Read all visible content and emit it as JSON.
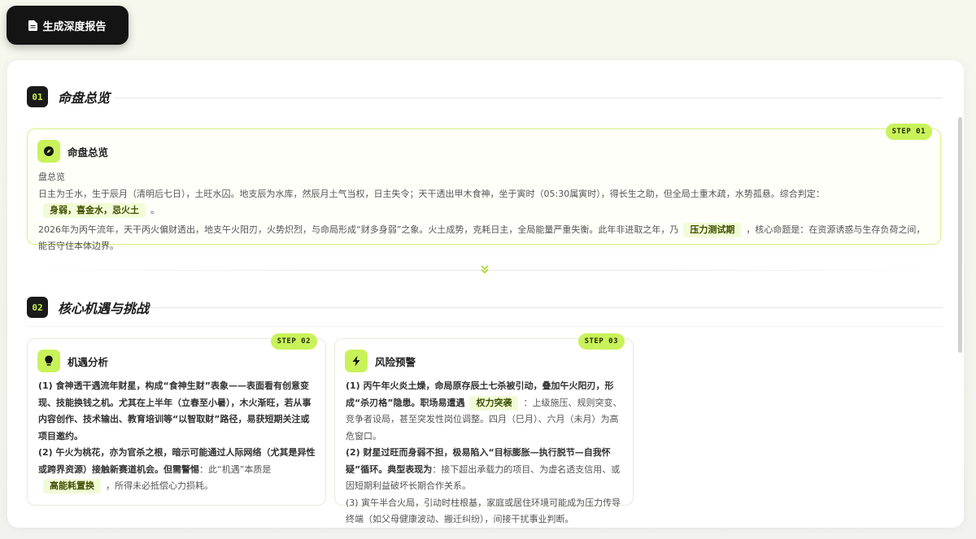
{
  "top_button": {
    "label": "生成深度报告",
    "icon": "document-icon"
  },
  "section1": {
    "number": "01",
    "title": "命盘总览"
  },
  "card1": {
    "step": "STEP 01",
    "title": "命盘总览",
    "icon": "compass-icon",
    "subtitle": "盘总览",
    "para1_text": "日主为壬水，生于辰月（清明后七日），土旺水囚。地支辰为水库，然辰月土气当权，日主失令；天干透出甲木食神，坐于寅时（05:30属寅时），得长生之助，但全局土重木疏，水势孤悬。综合判定：",
    "para1_tag": "身弱，喜金水，忌火土",
    "para1_end": "。",
    "para2_text": "2026年为丙午流年，天干丙火偏财透出，地支午火阳刃，火势炽烈，与命局形成“财多身弱”之象。火土成势，克耗日主，全局能量严重失衡。此年非进取之年，乃",
    "para2_tag": "压力测试期",
    "para2_end": "，核心命题是：在资源诱惑与生存负荷之间，能否守住本体边界。"
  },
  "section2": {
    "number": "02",
    "title": "核心机遇与挑战"
  },
  "card2": {
    "step": "STEP 02",
    "title": "机遇分析",
    "icon": "lightbulb-icon",
    "p1_strong": "(1) 食神透干遇流年财星，构成“食神生财”表象——表面看有创意变现、技能换钱之机。尤其在上半年（立春至小暑），木火渐旺，若从事内容创作、技术输出、教育培训等“以智取财”路径，易获短期关注或项目邀约。",
    "p2_strong": "(2) 午火为桃花，亦为官杀之根，暗示可能通过人际网络（尤其是异性或跨界资源）接触新赛道机会。但需警惕",
    "p2_text": "：此“机遇”本质是",
    "p2_tag": "高能耗置换",
    "p2_end": "，所得未必抵偿心力损耗。"
  },
  "card3": {
    "step": "STEP 03",
    "title": "风险预警",
    "icon": "lightning-icon",
    "p1_strong": "(1) 丙午年火炎土燥，命局原存辰土七杀被引动，叠加午火阳刃，形成“杀刃格”隐患。职场易遭遇",
    "p1_tag": "权力突袭",
    "p1_text": "：上级施压、规则突变、竞争者设局，甚至突发性岗位调整。四月（巳月）、六月（未月）为高危窗口。",
    "p2_strong": "(2) 财星过旺而身弱不担，极易陷入“目标膨胀—执行脱节—自我怀疑”循环。典型表现为",
    "p2_text": "：接下超出承载力的项目、为虚名透支信用、或因短期利益破坏长期合作关系。",
    "p3_text": "(3) 寅午半合火局，引动时柱根基，家庭或居住环境可能成为压力传导终端（如父母健康波动、搬迁纠纷），间接干扰事业判断。"
  },
  "colors": {
    "accent": "#c9f25a",
    "dark": "#141414",
    "tag_bg": "#f2fbd7"
  }
}
